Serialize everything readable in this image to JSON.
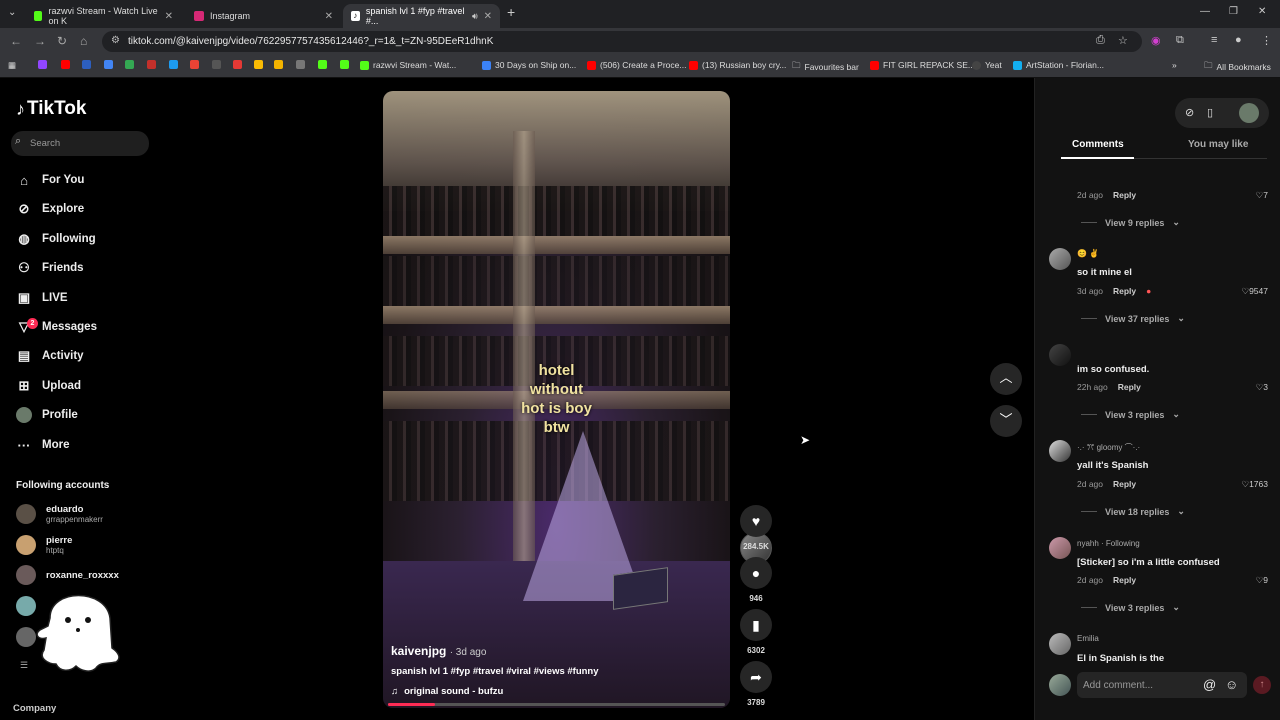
{
  "browser": {
    "tabs": [
      {
        "title": "razwvi Stream - Watch Live on K",
        "color": "#53fc18"
      },
      {
        "title": "Instagram",
        "color": "#d62976"
      },
      {
        "title": "spanish lvl 1 #fyp #travel #...",
        "color": "#111111"
      }
    ],
    "new_tab": "+",
    "url": "tiktok.com/@kaivenjpg/video/7622957757435612446?_r=1&_t=ZN-95DEeR1dhnK",
    "bookmarks": [
      {
        "label": "razwvi Stream - Wat...",
        "color": "#53fc18"
      },
      {
        "label": "30 Days on Ship on...",
        "color": "#3b82f6"
      },
      {
        "label": "(506) Create a Proce...",
        "color": "#ff0000"
      },
      {
        "label": "(13) Russian boy cry...",
        "color": "#ff0000"
      },
      {
        "label": "Favourites bar",
        "color": "#aaaaaa"
      },
      {
        "label": "FIT GIRL REPACK SE...",
        "color": "#ff0000"
      },
      {
        "label": "Yeat",
        "color": "#222222"
      },
      {
        "label": "ArtStation - Florian...",
        "color": "#13aff0"
      }
    ],
    "all_bookmarks": "All Bookmarks"
  },
  "sidebar": {
    "logo": "TikTok",
    "search_placeholder": "Search",
    "nav": [
      {
        "label": "For You",
        "icon": "home-icon"
      },
      {
        "label": "Explore",
        "icon": "compass-icon"
      },
      {
        "label": "Following",
        "icon": "following-icon"
      },
      {
        "label": "Friends",
        "icon": "friends-icon"
      },
      {
        "label": "LIVE",
        "icon": "live-icon"
      },
      {
        "label": "Messages",
        "icon": "messages-icon"
      },
      {
        "label": "Activity",
        "icon": "activity-icon"
      },
      {
        "label": "Upload",
        "icon": "upload-icon"
      },
      {
        "label": "Profile",
        "icon": "avatar"
      },
      {
        "label": "More",
        "icon": "more-icon"
      }
    ],
    "messages_badge": "2",
    "following_title": "Following accounts",
    "accounts": [
      {
        "name": "eduardo",
        "handle": "grrappenmakerr"
      },
      {
        "name": "pierre",
        "handle": "htptq"
      },
      {
        "name": "roxanne_roxxxx",
        "handle": ""
      }
    ],
    "company": "Company"
  },
  "video": {
    "overlay_text": [
      "hotel",
      "without",
      "hot is boy",
      "btw"
    ],
    "username": "kaivenjpg",
    "ago": "· 3d ago",
    "description": "spanish lvl 1 #fyp #travel #viral #views #funny",
    "sound": "original sound - bufzu",
    "progress": 0.14
  },
  "actions": {
    "likes": "284.5K",
    "comments": "946",
    "saves": "6302",
    "shares": "3789"
  },
  "panel": {
    "tab_comments": "Comments",
    "tab_you_may_like": "You may like",
    "reply_label": "Reply",
    "comments": [
      {
        "name": "",
        "text": "",
        "ago": "2d ago",
        "likes": "7",
        "replies": "View 9 replies"
      },
      {
        "name": "😊 ✌",
        "text": "so it mine el",
        "ago": "3d ago",
        "likes": "9547",
        "replies": "View 37 replies"
      },
      {
        "name": "",
        "text": "im so confused.",
        "ago": "22h ago",
        "likes": "3",
        "replies": "View 3 replies"
      },
      {
        "name": "·.· ꔫ gloomy ⌒·.·",
        "text": "yall it's Spanish",
        "ago": "2d ago",
        "likes": "1763",
        "replies": "View 18 replies"
      },
      {
        "name": "nyahh · Following",
        "text": "[Sticker] so i'm a little confused",
        "ago": "2d ago",
        "likes": "9",
        "replies": "View 3 replies"
      },
      {
        "name": "Emilia",
        "text": "El in Spanish is the",
        "ago": "",
        "likes": "",
        "replies": ""
      }
    ],
    "add_comment_placeholder": "Add comment...",
    "at_symbol": "@"
  }
}
